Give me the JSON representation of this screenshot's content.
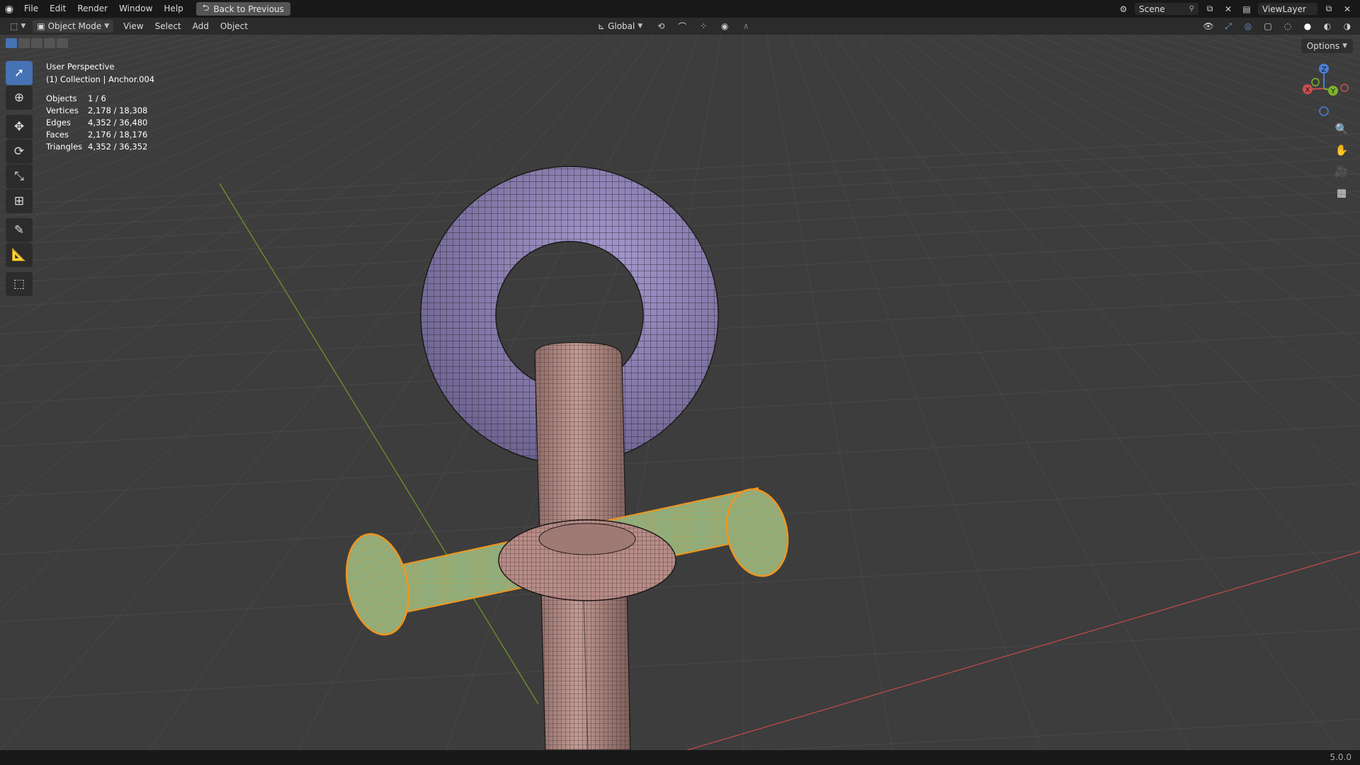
{
  "topbar": {
    "menus": [
      "File",
      "Edit",
      "Render",
      "Window",
      "Help"
    ],
    "back_button": "Back to Previous",
    "scene_name": "Scene",
    "view_layer": "ViewLayer"
  },
  "header": {
    "mode": "Object Mode",
    "menus": [
      "View",
      "Select",
      "Add",
      "Object"
    ],
    "transform_orientation": "Global",
    "options_label": "Options"
  },
  "overlay_info": {
    "view_name": "User Perspective",
    "collection_line": "(1) Collection | Anchor.004",
    "stats": [
      {
        "label": "Objects",
        "value": "1 / 6"
      },
      {
        "label": "Vertices",
        "value": "2,178 / 18,308"
      },
      {
        "label": "Edges",
        "value": "4,352 / 36,480"
      },
      {
        "label": "Faces",
        "value": "2,176 / 18,176"
      },
      {
        "label": "Triangles",
        "value": "4,352 / 36,352"
      }
    ]
  },
  "gizmo": {
    "x": "X",
    "y": "Y",
    "z": "Z"
  },
  "status": {
    "version": "5.0.0"
  },
  "colors": {
    "ring": "#8f83b6",
    "shaft": "#b78c87",
    "stock": "#8fae7d",
    "selection": "#f0961e",
    "x_axis": "#c44a4a",
    "y_axis": "#6f9a2a"
  }
}
